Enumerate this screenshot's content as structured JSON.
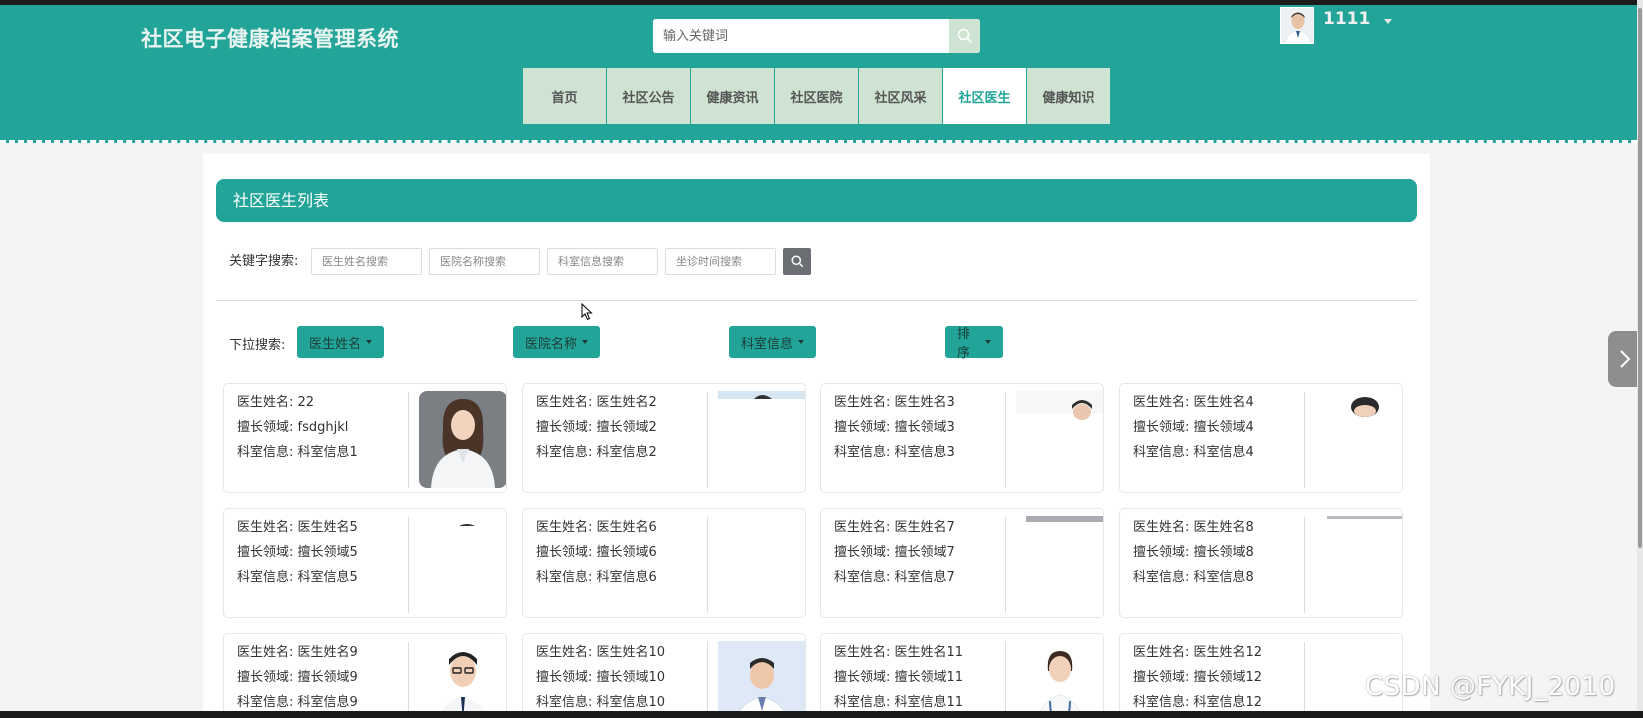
{
  "app": {
    "title": "社区电子健康档案管理系统",
    "search_placeholder": "输入关键词",
    "username": "1111"
  },
  "nav": {
    "items": [
      "首页",
      "社区公告",
      "健康资讯",
      "社区医院",
      "社区风采",
      "社区医生",
      "健康知识"
    ],
    "active_index": 5
  },
  "section": {
    "title": "社区医生列表"
  },
  "keyword_search": {
    "label": "关键字搜索:",
    "placeholders": [
      "医生姓名搜索",
      "医院名称搜索",
      "科室信息搜索",
      "坐诊时间搜索"
    ]
  },
  "dropdown_search": {
    "label": "下拉搜索:",
    "buttons": [
      "医生姓名",
      "医院名称",
      "科室信息",
      "排序"
    ]
  },
  "doctors": [
    {
      "name_label": "医生姓名: 22",
      "field_label": "擅长领域: fsdghjkl",
      "dept_label": "科室信息: 科室信息1",
      "photo": "female-doctor-gray"
    },
    {
      "name_label": "医生姓名: 医生姓名2",
      "field_label": "擅长领域: 擅长领域2",
      "dept_label": "科室信息: 科室信息2",
      "photo": "partial-top"
    },
    {
      "name_label": "医生姓名: 医生姓名3",
      "field_label": "擅长领域: 擅长领域3",
      "dept_label": "科室信息: 科室信息3",
      "photo": "partial-head"
    },
    {
      "name_label": "医生姓名: 医生姓名4",
      "field_label": "擅长领域: 擅长领域4",
      "dept_label": "科室信息: 科室信息4",
      "photo": "partial-head"
    },
    {
      "name_label": "医生姓名: 医生姓名5",
      "field_label": "擅长领域: 擅长领域5",
      "dept_label": "科室信息: 科室信息5",
      "photo": "partial-top"
    },
    {
      "name_label": "医生姓名: 医生姓名6",
      "field_label": "擅长领域: 擅长领域6",
      "dept_label": "科室信息: 科室信息6",
      "photo": "blank"
    },
    {
      "name_label": "医生姓名: 医生姓名7",
      "field_label": "擅长领域: 擅长领域7",
      "dept_label": "科室信息: 科室信息7",
      "photo": "partial-bar"
    },
    {
      "name_label": "医生姓名: 医生姓名8",
      "field_label": "擅长领域: 擅长领域8",
      "dept_label": "科室信息: 科室信息8",
      "photo": "partial-bar"
    },
    {
      "name_label": "医生姓名: 医生姓名9",
      "field_label": "擅长领域: 擅长领域9",
      "dept_label": "科室信息: 科室信息9",
      "photo": "male-doctor-glasses"
    },
    {
      "name_label": "医生姓名: 医生姓名10",
      "field_label": "擅长领域: 擅长领域10",
      "dept_label": "科室信息: 科室信息10",
      "photo": "male-doctor-blue"
    },
    {
      "name_label": "医生姓名: 医生姓名11",
      "field_label": "擅长领域: 擅长领域11",
      "dept_label": "科室信息: 科室信息11",
      "photo": "female-doctor-stethoscope"
    },
    {
      "name_label": "医生姓名: 医生姓名12",
      "field_label": "擅长领域: 擅长领域12",
      "dept_label": "科室信息: 科室信息12",
      "photo": "blank"
    }
  ],
  "watermark": "CSDN @FYKJ_2010",
  "colors": {
    "primary": "#22a598",
    "nav_bg": "#cfe3d2",
    "search_btn": "#6b6f73"
  },
  "icons": {
    "header_search": "search-icon",
    "keyword_search": "search-icon",
    "side_tab": "chevron-right-icon",
    "user_menu": "caret-down-icon"
  }
}
